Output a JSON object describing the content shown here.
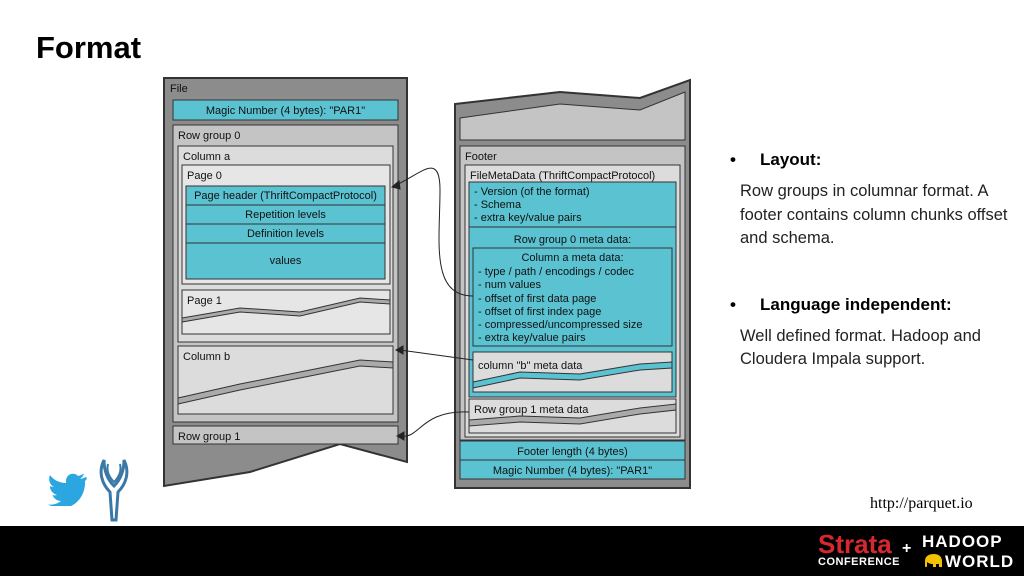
{
  "title": "Format",
  "diagram": {
    "file": {
      "label": "File",
      "magic": "Magic Number (4 bytes): \"PAR1\"",
      "row_group_0": "Row group 0",
      "column_a": "Column a",
      "page_0": "Page 0",
      "page_header": "Page header (ThriftCompactProtocol)",
      "repetition": "Repetition levels",
      "definition": "Definition levels",
      "values": "values",
      "page_1": "Page 1",
      "column_b": "Column b",
      "row_group_1": "Row group 1"
    },
    "footer": {
      "label": "Footer",
      "filemetadata": "FileMetaData (ThriftCompactProtocol)",
      "version": "- Version (of the format)",
      "schema": "- Schema",
      "extra_kv": "- extra key/value pairs",
      "rg0_meta": "Row group 0 meta data:",
      "col_a_meta": "Column a meta data:",
      "type_path": "- type / path / encodings / codec",
      "num_values": "- num values",
      "offset_data": "- offset of first data page",
      "offset_index": "- offset of first index page",
      "compressed": "- compressed/uncompressed size",
      "extra_kv2": "- extra key/value pairs",
      "col_b_meta": "column \"b\" meta data",
      "rg1_meta": "Row group 1 meta data",
      "footer_length": "Footer length (4 bytes)",
      "magic": "Magic Number (4 bytes): \"PAR1\""
    }
  },
  "bullets": [
    {
      "heading": "Layout:",
      "body": "Row groups in columnar format. A footer contains column chunks offset and schema."
    },
    {
      "heading": "Language independent:",
      "body": "Well defined format. Hadoop and Cloudera Impala support."
    }
  ],
  "url": "http://parquet.io",
  "logos": {
    "strata": "Strata",
    "conference": "CONFERENCE",
    "plus": "+",
    "hadoop": "HADOOP",
    "world": "WORLD"
  },
  "colors": {
    "cyan": "#5bc2d1",
    "gray_dark": "#8c8c8c",
    "gray_mid": "#c4c4c4",
    "gray_light": "#dcdcdc",
    "black": "#000000",
    "strata_red": "#d7282f",
    "twitter_blue": "#2ba6e1",
    "horns_blue": "#3a78a8"
  }
}
